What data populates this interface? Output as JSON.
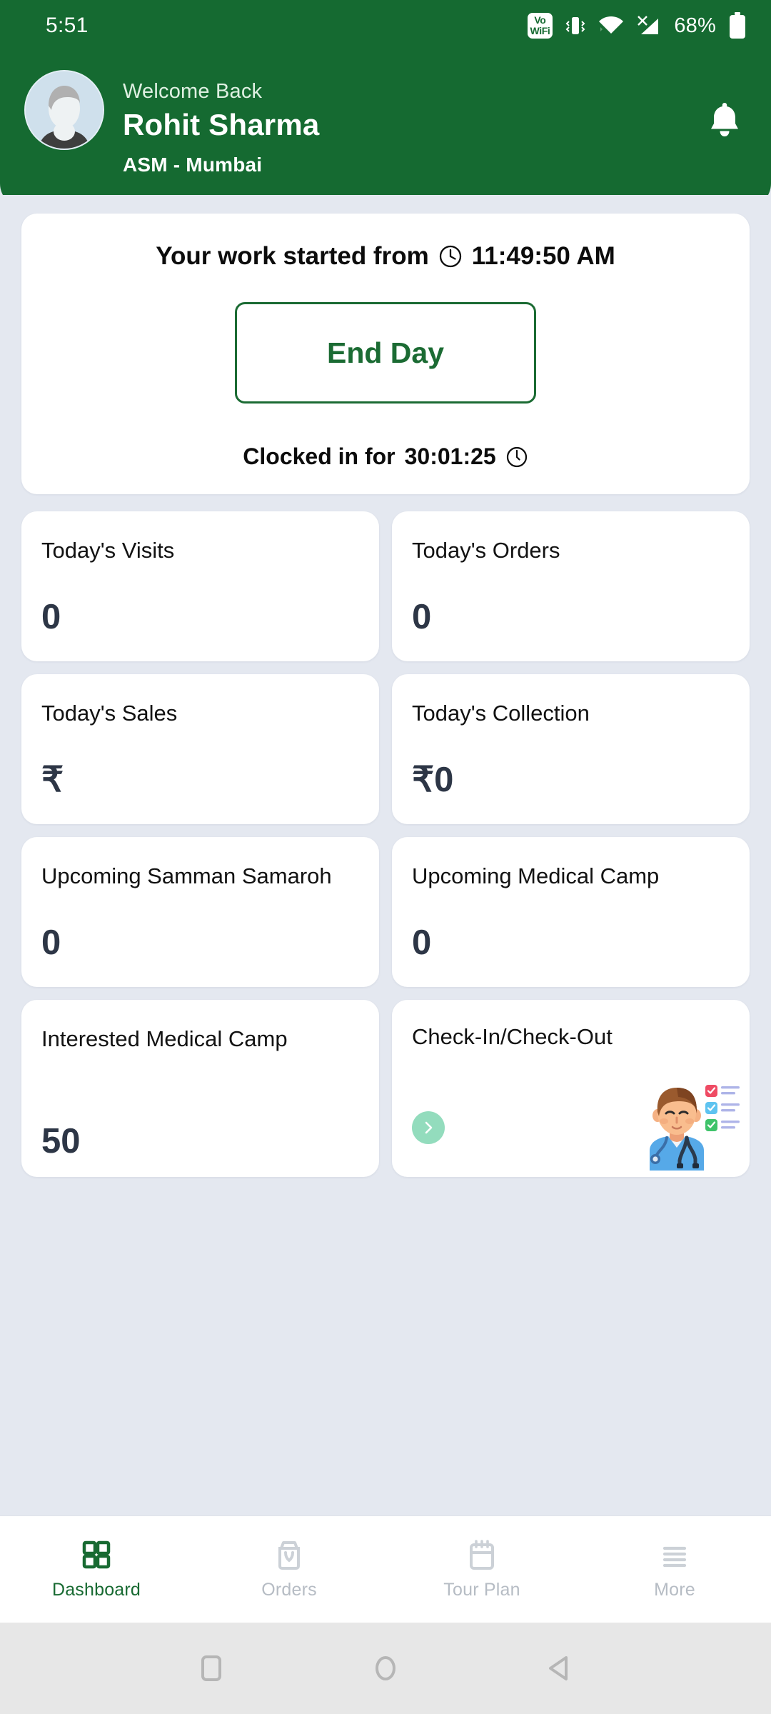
{
  "status_bar": {
    "time": "5:51",
    "vowifi_line1": "Vo",
    "vowifi_line2": "WiFi",
    "battery_percent": "68%",
    "icons": [
      "vowifi-icon",
      "vibrate-icon",
      "wifi-icon",
      "signal-no-service-icon",
      "battery-icon"
    ]
  },
  "header": {
    "welcome": "Welcome Back",
    "user_name": "Rohit Sharma",
    "user_role": "ASM - Mumbai",
    "bell_icon": "notification-bell-icon",
    "avatar_icon": "user-avatar-placeholder",
    "bg_color": "#156A31"
  },
  "work_card": {
    "started_prefix": "Your work started from",
    "clock_icon": "clock-icon",
    "start_time": "11:49:50 AM",
    "end_day_label": "End Day",
    "clocked_prefix": "Clocked in for",
    "clocked_duration": "30:01:25",
    "stopwatch_icon": "stopwatch-icon",
    "accent_color": "#1b6b33"
  },
  "stats": [
    {
      "label": "Today's Visits",
      "value": "0"
    },
    {
      "label": "Today's Orders",
      "value": "0"
    },
    {
      "label": "Today's Sales",
      "value": "₹"
    },
    {
      "label": "Today's Collection",
      "value": "₹0"
    },
    {
      "label": "Upcoming Samman Samaroh",
      "value": "0"
    },
    {
      "label": "Upcoming Medical Camp",
      "value": "0"
    },
    {
      "label": "Interested Medical Camp",
      "value": "50"
    }
  ],
  "checkin_card": {
    "title": "Check-In/Check-Out",
    "go_icon": "chevron-right-icon",
    "illustration": "doctor-with-checklist-illustration",
    "go_button_color": "#93dcbd"
  },
  "bottom_nav": {
    "items": [
      {
        "label": "Dashboard",
        "icon": "grid-dashboard-icon",
        "active": true
      },
      {
        "label": "Orders",
        "icon": "shopping-bag-icon",
        "active": false
      },
      {
        "label": "Tour Plan",
        "icon": "calendar-icon",
        "active": false
      },
      {
        "label": "More",
        "icon": "hamburger-menu-icon",
        "active": false
      }
    ],
    "active_color": "#186A32",
    "inactive_color": "#b6bcc4"
  },
  "android_nav": {
    "recents_icon": "square-recents-icon",
    "home_icon": "circle-home-icon",
    "back_icon": "triangle-back-icon"
  }
}
